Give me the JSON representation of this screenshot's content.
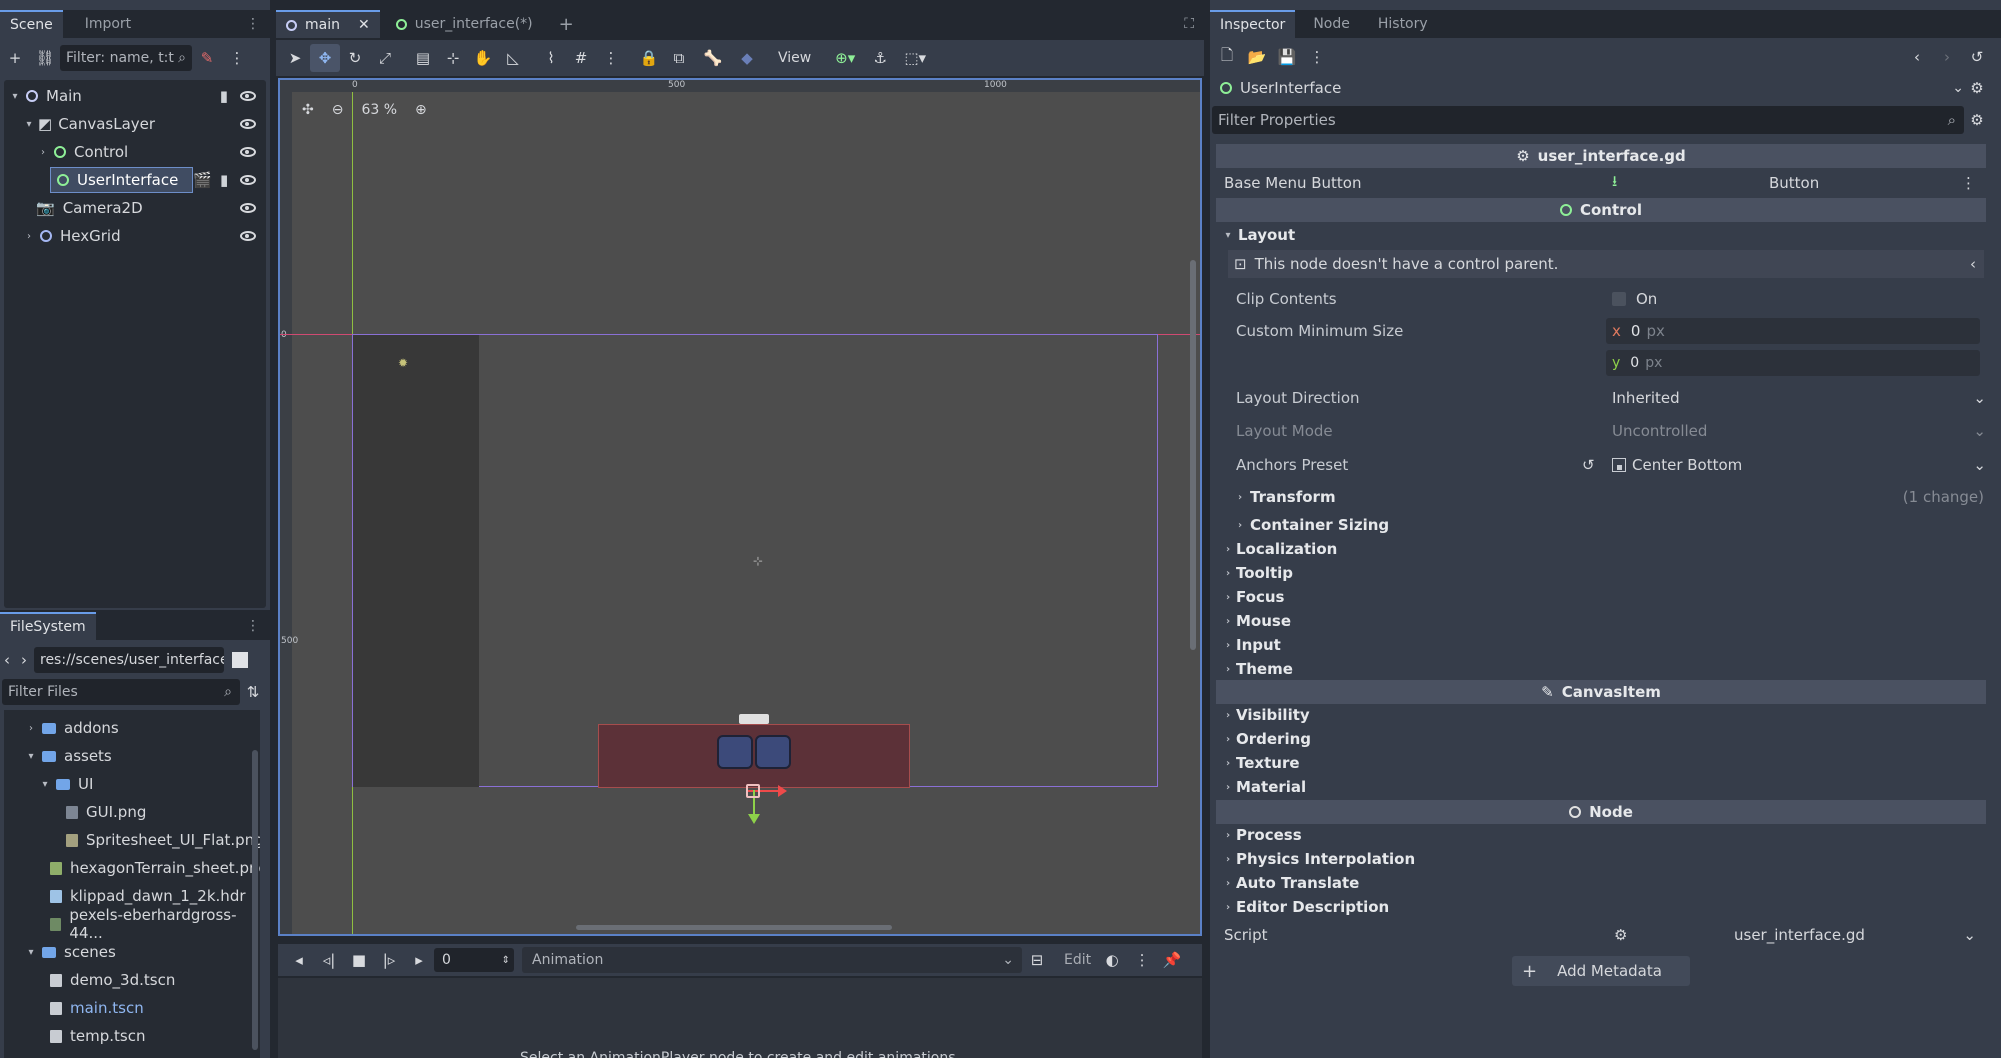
{
  "scene_dock": {
    "tabs": [
      "Scene",
      "Import"
    ],
    "filter_placeholder": "Filter: name, t:t",
    "nodes": [
      {
        "label": "Main"
      },
      {
        "label": "CanvasLayer"
      },
      {
        "label": "Control"
      },
      {
        "label": "UserInterface"
      },
      {
        "label": "Camera2D"
      },
      {
        "label": "HexGrid"
      }
    ]
  },
  "filesystem": {
    "tab": "FileSystem",
    "path": "res://scenes/user_interface.",
    "filter_placeholder": "Filter Files",
    "items": [
      {
        "label": "addons"
      },
      {
        "label": "assets"
      },
      {
        "label": "UI"
      },
      {
        "label": "GUI.png"
      },
      {
        "label": "Spritesheet_UI_Flat.png"
      },
      {
        "label": "hexagonTerrain_sheet.png"
      },
      {
        "label": "klippad_dawn_1_2k.hdr"
      },
      {
        "label": "pexels-eberhardgross-44..."
      },
      {
        "label": "scenes"
      },
      {
        "label": "demo_3d.tscn"
      },
      {
        "label": "main.tscn"
      },
      {
        "label": "temp.tscn"
      }
    ]
  },
  "editor": {
    "tabs": [
      "main",
      "user_interface(*)"
    ],
    "view_label": "View",
    "zoom": "63 %",
    "ruler_marks": [
      "0",
      "500",
      "1000"
    ],
    "ruler_v_marks": [
      "0",
      "500"
    ]
  },
  "animation": {
    "frame_value": "0",
    "label": "Animation",
    "edit_label": "Edit",
    "hint": "Select an AnimationPlayer node to create and edit animations."
  },
  "inspector": {
    "tabs": [
      "Inspector",
      "Node",
      "History"
    ],
    "node_name": "UserInterface",
    "filter_placeholder": "Filter Properties",
    "script_header": "user_interface.gd",
    "base_menu_button_label": "Base Menu Button",
    "base_menu_button_value": "Button",
    "control_header": "Control",
    "layout_group": "Layout",
    "layout_warning": "This node doesn't have a control parent.",
    "clip_contents_label": "Clip Contents",
    "clip_contents_value": "On",
    "custom_min_size_label": "Custom Minimum Size",
    "min_x": "0",
    "min_y": "0",
    "unit": "px",
    "axis_x": "x",
    "axis_y": "y",
    "layout_direction_label": "Layout Direction",
    "layout_direction_value": "Inherited",
    "layout_mode_label": "Layout Mode",
    "layout_mode_value": "Uncontrolled",
    "anchors_preset_label": "Anchors Preset",
    "anchors_preset_value": "Center Bottom",
    "transform_label": "Transform",
    "transform_changes": "(1 change)",
    "container_sizing_label": "Container Sizing",
    "control_groups": [
      "Localization",
      "Tooltip",
      "Focus",
      "Mouse",
      "Input",
      "Theme"
    ],
    "canvasitem_header": "CanvasItem",
    "canvasitem_groups": [
      "Visibility",
      "Ordering",
      "Texture",
      "Material"
    ],
    "node_header": "Node",
    "node_groups": [
      "Process",
      "Physics Interpolation",
      "Auto Translate",
      "Editor Description"
    ],
    "script_label": "Script",
    "script_value": "user_interface.gd",
    "add_metadata": "Add Metadata"
  }
}
